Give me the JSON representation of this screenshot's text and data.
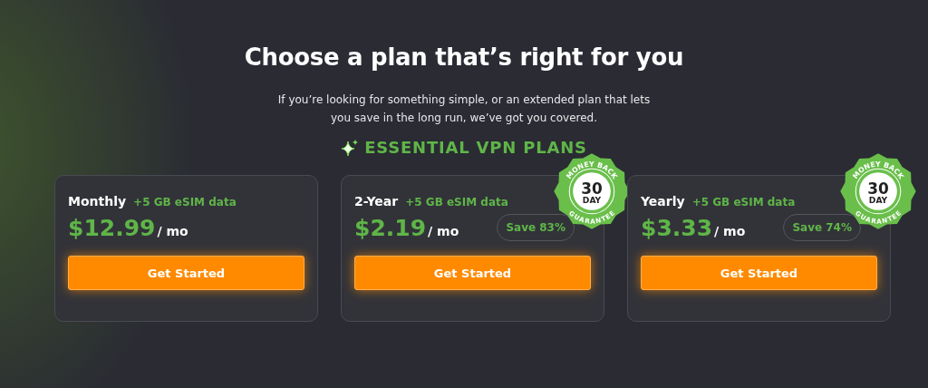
{
  "header": {
    "title": "Choose a plan that’s right for you",
    "subtitle": "If you’re looking for something simple, or an extended plan that lets you save in the long run, we’ve got you covered.",
    "section": "ESSENTIAL VPN PLANS"
  },
  "plans": [
    {
      "name": "Monthly",
      "extra": "+5 GB eSIM data",
      "price": "$12.99",
      "unit": "/ mo",
      "button": "Get Started"
    },
    {
      "name": "2-Year",
      "extra": "+5 GB eSIM data",
      "price": "$2.19",
      "unit": "/ mo",
      "save": "Save 83%",
      "badge": {
        "top": "MONEY BACK",
        "number": "30",
        "unit": "DAY",
        "bottom": "GUARANTEE"
      },
      "button": "Get Started"
    },
    {
      "name": "Yearly",
      "extra": "+5 GB eSIM data",
      "price": "$3.33",
      "unit": "/ mo",
      "save": "Save 74%",
      "badge": {
        "top": "MONEY BACK",
        "number": "30",
        "unit": "DAY",
        "bottom": "GUARANTEE"
      },
      "button": "Get Started"
    }
  ]
}
